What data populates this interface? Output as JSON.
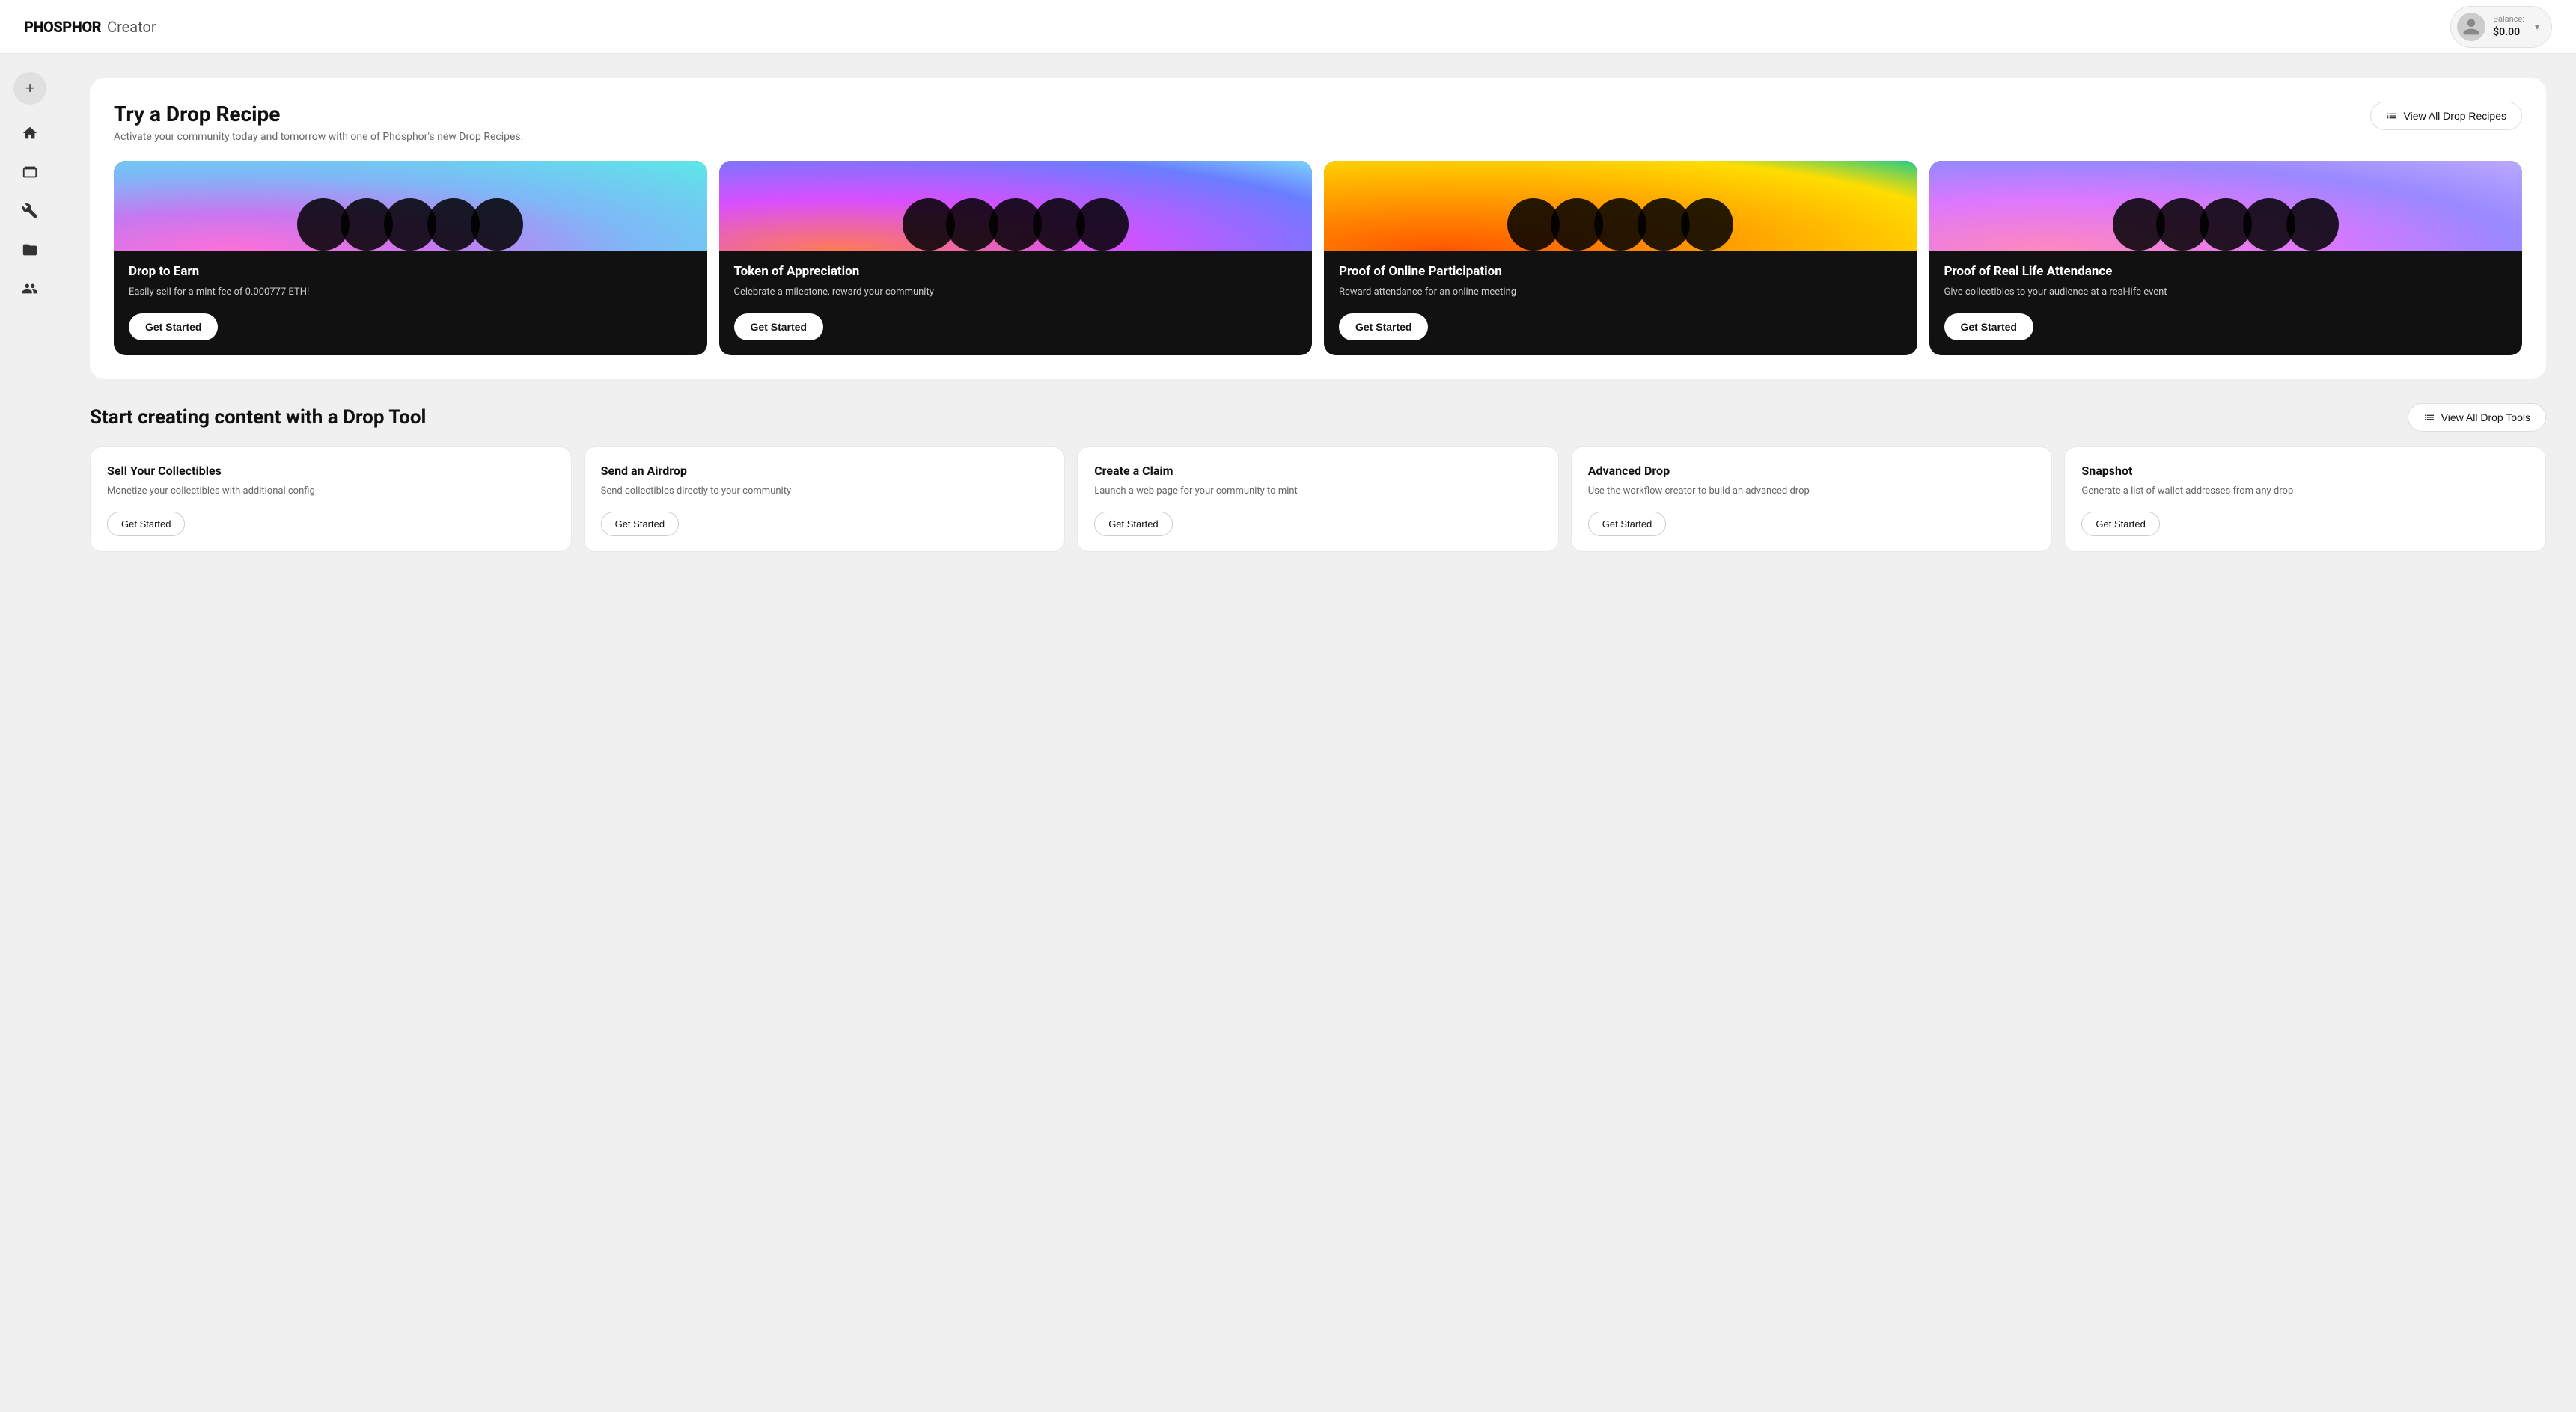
{
  "header": {
    "logo_bold": "PHOSPHOR",
    "logo_light": "Creator",
    "balance_label": "Balance:",
    "balance_value": "$0.00"
  },
  "sidebar": {
    "add_label": "+",
    "icons": [
      {
        "name": "home-icon",
        "label": "Home"
      },
      {
        "name": "collection-icon",
        "label": "Collections"
      },
      {
        "name": "tools-icon",
        "label": "Tools"
      },
      {
        "name": "folder-icon",
        "label": "Files"
      },
      {
        "name": "team-icon",
        "label": "Team"
      }
    ]
  },
  "drop_recipes": {
    "section_title": "Try a Drop Recipe",
    "section_subtitle": "Activate your community today and tomorrow with one of Phosphor's new Drop Recipes.",
    "view_all_label": "View All Drop Recipes",
    "cards": [
      {
        "title": "Drop to Earn",
        "description": "Easily sell for a mint fee of 0.000777 ETH!",
        "btn_label": "Get Started",
        "gradient": "gradient-1"
      },
      {
        "title": "Token of Appreciation",
        "description": "Celebrate a milestone, reward your community",
        "btn_label": "Get Started",
        "gradient": "gradient-2"
      },
      {
        "title": "Proof of Online Participation",
        "description": "Reward attendance for an online meeting",
        "btn_label": "Get Started",
        "gradient": "gradient-3"
      },
      {
        "title": "Proof of Real Life Attendance",
        "description": "Give collectibles to your audience at a real-life event",
        "btn_label": "Get Started",
        "gradient": "gradient-4"
      }
    ]
  },
  "drop_tools": {
    "section_title": "Start creating content with a Drop Tool",
    "view_all_label": "View All Drop Tools",
    "cards": [
      {
        "title": "Sell Your Collectibles",
        "description": "Monetize your collectibles with additional config",
        "btn_label": "Get Started"
      },
      {
        "title": "Send an Airdrop",
        "description": "Send collectibles directly to your community",
        "btn_label": "Get Started"
      },
      {
        "title": "Create a Claim",
        "description": "Launch a web page for your community to mint",
        "btn_label": "Get Started"
      },
      {
        "title": "Advanced Drop",
        "description": "Use the workflow creator to build an advanced drop",
        "btn_label": "Get Started"
      },
      {
        "title": "Snapshot",
        "description": "Generate a list of wallet addresses from any drop",
        "btn_label": "Get Started"
      }
    ]
  }
}
